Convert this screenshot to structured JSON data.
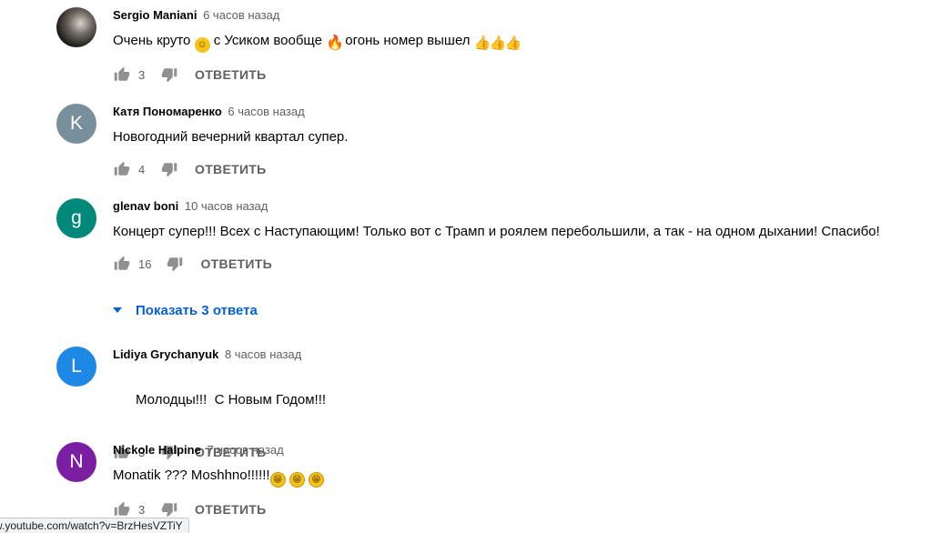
{
  "comments": [
    {
      "author": "Sergio Maniani",
      "time": "6 часов назад",
      "avatar": {
        "type": "photo",
        "letter": "",
        "color": ""
      },
      "text_segments": [
        {
          "t": "Очень круто "
        },
        {
          "emoji": "smile-emoji",
          "glyph": "☺"
        },
        {
          "t": " с Усиком вообще "
        },
        {
          "emoji": "fire-emoji",
          "glyph": "🔥"
        },
        {
          "t": " огонь номер вышел "
        },
        {
          "emoji": "thumbs-up-emoji",
          "glyph": "👍"
        },
        {
          "emoji": "thumbs-up-emoji",
          "glyph": "👍"
        },
        {
          "emoji": "thumbs-up-emoji",
          "glyph": "👍"
        }
      ],
      "likes": "3",
      "reply_label": "ОТВЕТИТЬ"
    },
    {
      "author": "Катя Пономаренко",
      "time": "6 часов назад",
      "avatar": {
        "type": "letter",
        "letter": "K",
        "color": "#78909c"
      },
      "text_segments": [
        {
          "t": "Новогодний вечерний квартал супер."
        }
      ],
      "likes": "4",
      "reply_label": "ОТВЕТИТЬ"
    },
    {
      "author": "glenav boni",
      "time": "10 часов назад",
      "avatar": {
        "type": "letter",
        "letter": "g",
        "color": "#00897b"
      },
      "text_segments": [
        {
          "t": "Концерт супер!!! Всех с Наступающим! Только вот с Трамп и роялем перебольшили, а так - на одном дыхании! Спасибо!"
        }
      ],
      "likes": "16",
      "reply_label": "ОТВЕТИТЬ"
    },
    {
      "author": "Lidiya Grychanyuk",
      "time": "8 часов назад",
      "avatar": {
        "type": "letter",
        "letter": "L",
        "color": "#1e88e5"
      },
      "text_segments": [
        {
          "t": "Молодцы!!!  С Новым Годом!!!"
        }
      ],
      "likes": "3",
      "reply_label": "ОТВЕТИТЬ"
    },
    {
      "author": "Nickole Halpine",
      "time": "7 часов назад",
      "avatar": {
        "type": "letter",
        "letter": "N",
        "color": "#7b1fa2"
      },
      "text_segments": [
        {
          "t": "Monatik ??? Moshhno!!!!!!"
        },
        {
          "emoji": "grin-emoji",
          "glyph": "😁"
        },
        {
          "t": " "
        },
        {
          "emoji": "grin-emoji",
          "glyph": "😁"
        },
        {
          "t": " "
        },
        {
          "emoji": "grin-emoji",
          "glyph": "😁"
        }
      ],
      "likes": "3",
      "reply_label": "ОТВЕТИТЬ"
    }
  ],
  "show_replies_label": "Показать 3 ответа",
  "status_bar_url": "w.youtube.com/watch?v=BrzHesVZTiY",
  "colors": {
    "link_blue": "#065fd4",
    "meta_gray": "#606060",
    "icon_gray": "#909090"
  }
}
